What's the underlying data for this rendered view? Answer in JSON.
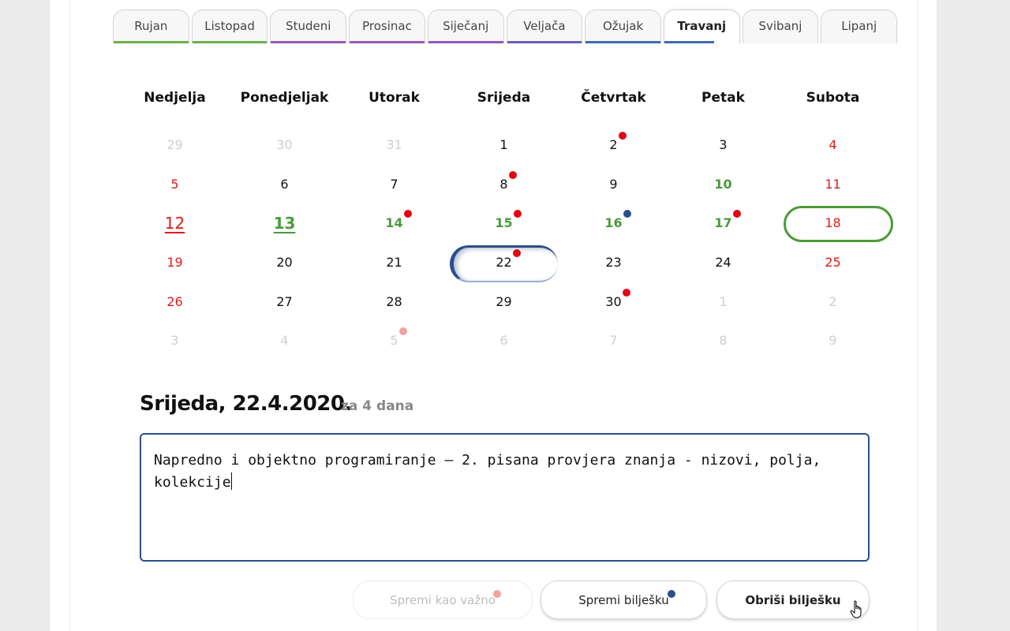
{
  "tabs": [
    {
      "label": "Rujan",
      "color": "#6ab04c",
      "active": false
    },
    {
      "label": "Listopad",
      "color": "#6ab04c",
      "active": false
    },
    {
      "label": "Studeni",
      "color": "#9b59b6",
      "active": false
    },
    {
      "label": "Prosinac",
      "color": "#9b59b6",
      "active": false
    },
    {
      "label": "Siječanj",
      "color": "#8e5bb7",
      "active": false
    },
    {
      "label": "Veljača",
      "color": "#6c5fb0",
      "active": false
    },
    {
      "label": "Ožujak",
      "color": "#3e6bb0",
      "active": false
    },
    {
      "label": "Travanj",
      "color": "#3e6bb0",
      "active": true
    },
    {
      "label": "Svibanj",
      "color": "",
      "active": false
    },
    {
      "label": "Lipanj",
      "color": "",
      "active": false
    }
  ],
  "calendar": {
    "weekdays": [
      "Nedjelja",
      "Ponedjeljak",
      "Utorak",
      "Srijeda",
      "Četvrtak",
      "Petak",
      "Subota"
    ],
    "days": [
      {
        "day": "29",
        "type": "other"
      },
      {
        "day": "30",
        "type": "other"
      },
      {
        "day": "31",
        "type": "other"
      },
      {
        "day": "1",
        "type": "normal"
      },
      {
        "day": "2",
        "type": "normal",
        "dot": "red"
      },
      {
        "day": "3",
        "type": "normal"
      },
      {
        "day": "4",
        "type": "weekend"
      },
      {
        "day": "5",
        "type": "weekend"
      },
      {
        "day": "6",
        "type": "normal"
      },
      {
        "day": "7",
        "type": "normal"
      },
      {
        "day": "8",
        "type": "normal",
        "dot": "red"
      },
      {
        "day": "9",
        "type": "normal"
      },
      {
        "day": "10",
        "type": "green"
      },
      {
        "day": "11",
        "type": "weekend"
      },
      {
        "day": "12",
        "type": "weekend",
        "big": true
      },
      {
        "day": "13",
        "type": "green",
        "big": true
      },
      {
        "day": "14",
        "type": "green",
        "dot": "red"
      },
      {
        "day": "15",
        "type": "green",
        "dot": "red"
      },
      {
        "day": "16",
        "type": "green",
        "dot": "blue"
      },
      {
        "day": "17",
        "type": "green",
        "dot": "red"
      },
      {
        "day": "18",
        "type": "weekend",
        "ring": "green"
      },
      {
        "day": "19",
        "type": "weekend"
      },
      {
        "day": "20",
        "type": "normal"
      },
      {
        "day": "21",
        "type": "normal"
      },
      {
        "day": "22",
        "type": "normal",
        "dot": "red",
        "ring": "blue"
      },
      {
        "day": "23",
        "type": "normal"
      },
      {
        "day": "24",
        "type": "normal"
      },
      {
        "day": "25",
        "type": "weekend"
      },
      {
        "day": "26",
        "type": "weekend"
      },
      {
        "day": "27",
        "type": "normal"
      },
      {
        "day": "28",
        "type": "normal"
      },
      {
        "day": "29",
        "type": "normal"
      },
      {
        "day": "30",
        "type": "normal",
        "dot": "red"
      },
      {
        "day": "1",
        "type": "other"
      },
      {
        "day": "2",
        "type": "other"
      },
      {
        "day": "3",
        "type": "other"
      },
      {
        "day": "4",
        "type": "other"
      },
      {
        "day": "5",
        "type": "other",
        "dot": "pink"
      },
      {
        "day": "6",
        "type": "other"
      },
      {
        "day": "7",
        "type": "other"
      },
      {
        "day": "8",
        "type": "other"
      },
      {
        "day": "9",
        "type": "other"
      }
    ],
    "dot_colors": {
      "red": "#e30613",
      "blue": "#2c4f8a",
      "pink": "#f4a0a0"
    }
  },
  "selected": {
    "date_title": "Srijeda, 22.4.2020.",
    "relative": "za 4 dana"
  },
  "note": {
    "text": "Napredno i objektno programiranje — 2. pisana provjera znanja - nizovi, polja, kolekcije"
  },
  "buttons": {
    "important": "Spremi kao važno",
    "save": "Spremi bilješku",
    "delete": "Obriši bilješku",
    "important_dot": "#f4a0a0",
    "save_dot": "#2c4f8a"
  }
}
